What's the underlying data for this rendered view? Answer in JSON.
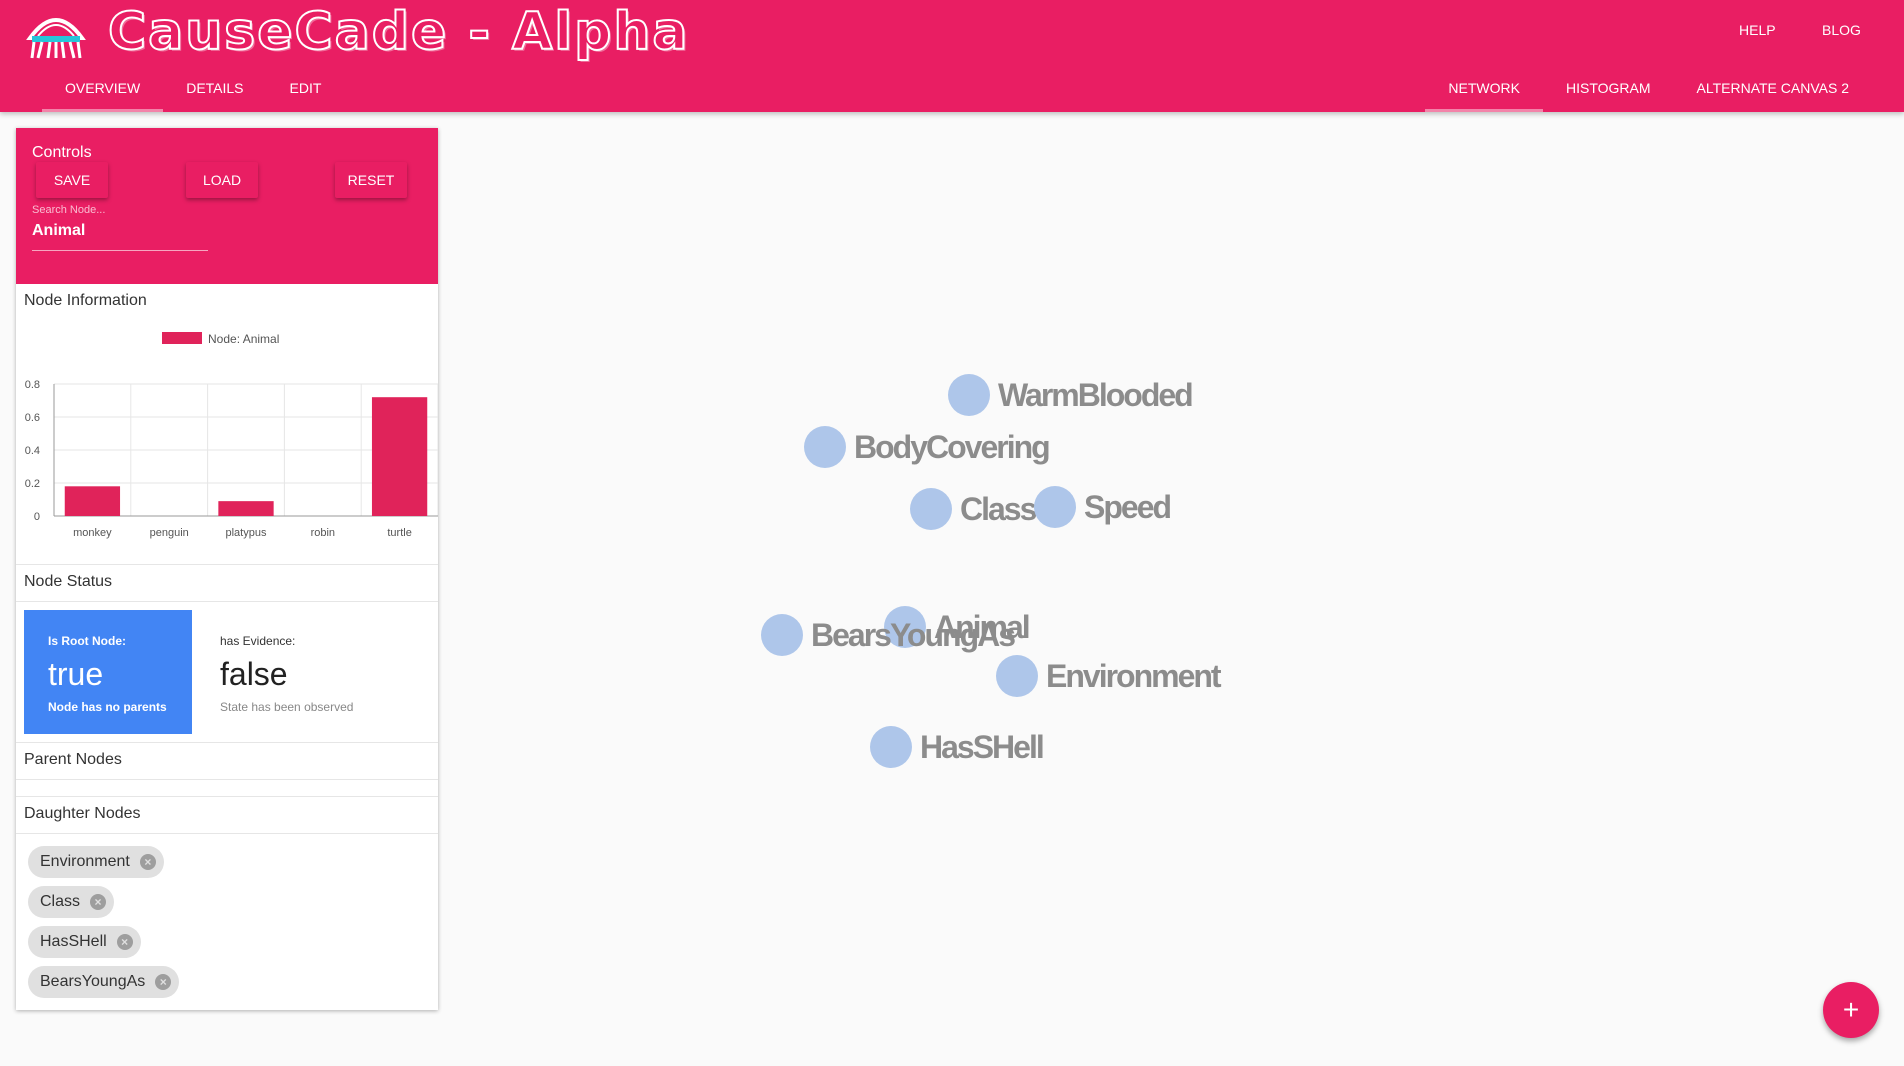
{
  "header": {
    "title": "CauseCade - Alpha",
    "logo_icon": "jellyfish-logo-icon",
    "help": "HELP",
    "blog": "BLOG",
    "tabs_left": [
      "OVERVIEW",
      "DETAILS",
      "EDIT"
    ],
    "tabs_right": [
      "NETWORK",
      "HISTOGRAM",
      "ALTERNATE CANVAS 2"
    ],
    "active_left": "OVERVIEW",
    "active_right": "NETWORK"
  },
  "controls": {
    "title": "Controls",
    "save": "SAVE",
    "load": "LOAD",
    "reset": "RESET",
    "search_placeholder": "Search Node...",
    "search_value": "Animal"
  },
  "node_information": {
    "title": "Node Information"
  },
  "chart_data": {
    "type": "bar",
    "categories": [
      "monkey",
      "penguin",
      "platypus",
      "robin",
      "turtle"
    ],
    "values": [
      0.18,
      0.0,
      0.09,
      0.0,
      0.72
    ],
    "legend": "Node: Animal",
    "ylim": [
      0,
      0.8
    ],
    "yticks": [
      "0",
      "0.2",
      "0.4",
      "0.6",
      "0.8"
    ],
    "grid": true,
    "color": "#e0235a"
  },
  "node_status": {
    "title": "Node Status",
    "root_label": "Is Root Node:",
    "root_value": "true",
    "root_sub": "Node has no parents",
    "evidence_label": "has Evidence:",
    "evidence_value": "false",
    "evidence_sub": "State has been observed"
  },
  "parent_nodes": {
    "title": "Parent Nodes"
  },
  "daughter_nodes": {
    "title": "Daughter Nodes",
    "items": [
      "Environment",
      "Class",
      "HasSHell",
      "BearsYoungAs"
    ]
  },
  "network_nodes": [
    "WarmBlooded",
    "BodyCovering",
    "Class",
    "Speed",
    "Animal",
    "BearsYoungAs",
    "Environment",
    "HasSHell"
  ],
  "fab": "+",
  "colors": {
    "primary": "#e91e63",
    "root_card": "#4285f4",
    "node": "#aec6ea",
    "node_label": "#8c8c8c"
  }
}
